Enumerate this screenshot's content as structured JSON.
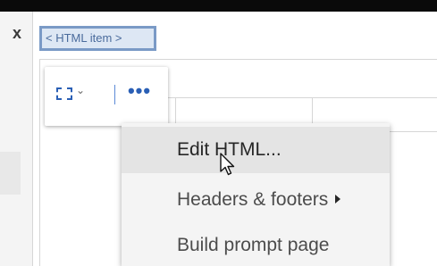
{
  "side_panel": {
    "close_glyph": "x"
  },
  "report": {
    "html_item_label": "< HTML item >"
  },
  "toolbar": {
    "select_icon": "dashed-selection-icon",
    "chevron_glyph": "⌄",
    "more_glyph": "•••",
    "accent_color": "#2a5fb5"
  },
  "context_menu": {
    "items": [
      {
        "label": "Edit HTML...",
        "state": "hovered"
      },
      {
        "label": "Headers & footers",
        "has_submenu": true
      },
      {
        "label": "Build prompt page"
      }
    ]
  },
  "colors": {
    "html_item_border": "#7a9ac6",
    "html_item_fill": "#dde7f4",
    "menu_background": "#f4f4f4",
    "menu_hover": "#e4e4e4"
  }
}
